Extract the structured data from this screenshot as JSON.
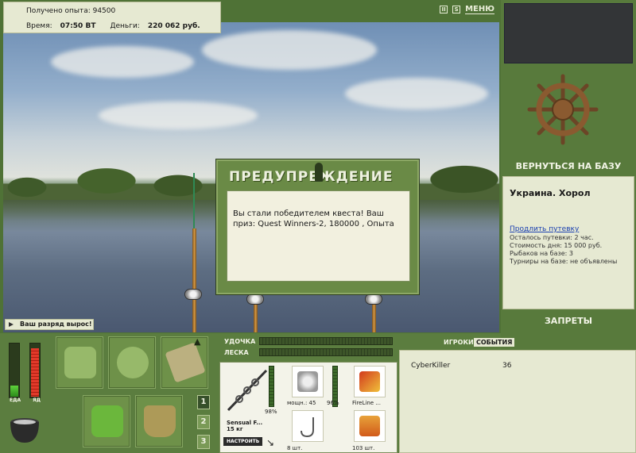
{
  "hud": {
    "exp_label": "Получено опыта: 94500",
    "time_label": "Время:",
    "time_value": "07:50 ВТ",
    "money_label": "Деньги:",
    "money_value": "220 062 руб.",
    "menu_label": "МЕНЮ",
    "sound_label": "S"
  },
  "dialog": {
    "title": "ПРЕДУПРЕЖДЕНИЕ",
    "message": "Вы стали победителем квеста! Ваш приз: Quest Winners-2, 180000 , Опыта"
  },
  "rank_notice": "Ваш разряд вырос!",
  "right_panel": {
    "back_to_base": "ВЕРНУТЬСЯ НА БАЗУ",
    "location": "Украина. Хорол",
    "extend_link": "Продлить путевку",
    "lines": [
      "Осталось путевки: 2 час.",
      "Стоимость дня: 15 000 руб.",
      "Рыбаков на базе: 3",
      "Турниры на базе: не объявлены"
    ],
    "bans": "ЗАПРЕТЫ"
  },
  "stats": {
    "food_label": "ЕДА",
    "poison_label": "ЯД",
    "food_level": 0.2,
    "poison_level": 0.9
  },
  "bottom": {
    "rod_label": "УДОЧКА",
    "line_label": "ЛЕСКА",
    "tabs": [
      "1",
      "2",
      "3"
    ],
    "rod_name": "Sensual F...",
    "rod_weight": "15 кг",
    "rod_percent": "98%",
    "setup_button": "НАСТРОИТЬ",
    "reel_power": "мощн.: 45",
    "reel_percent": "96%",
    "line_name": "FireLine ...",
    "hook_count": "8 шт.",
    "bait_count": "103 шт."
  },
  "players": {
    "tab_players": "ИГРОКИ",
    "tab_events": "СОБЫТИЯ",
    "rows": [
      {
        "name": "CyberKiller",
        "value": "36"
      }
    ]
  },
  "colors": {
    "panel_green": "#587a3c",
    "paper": "#e6e9d2",
    "link_blue": "#1a3fb0"
  }
}
